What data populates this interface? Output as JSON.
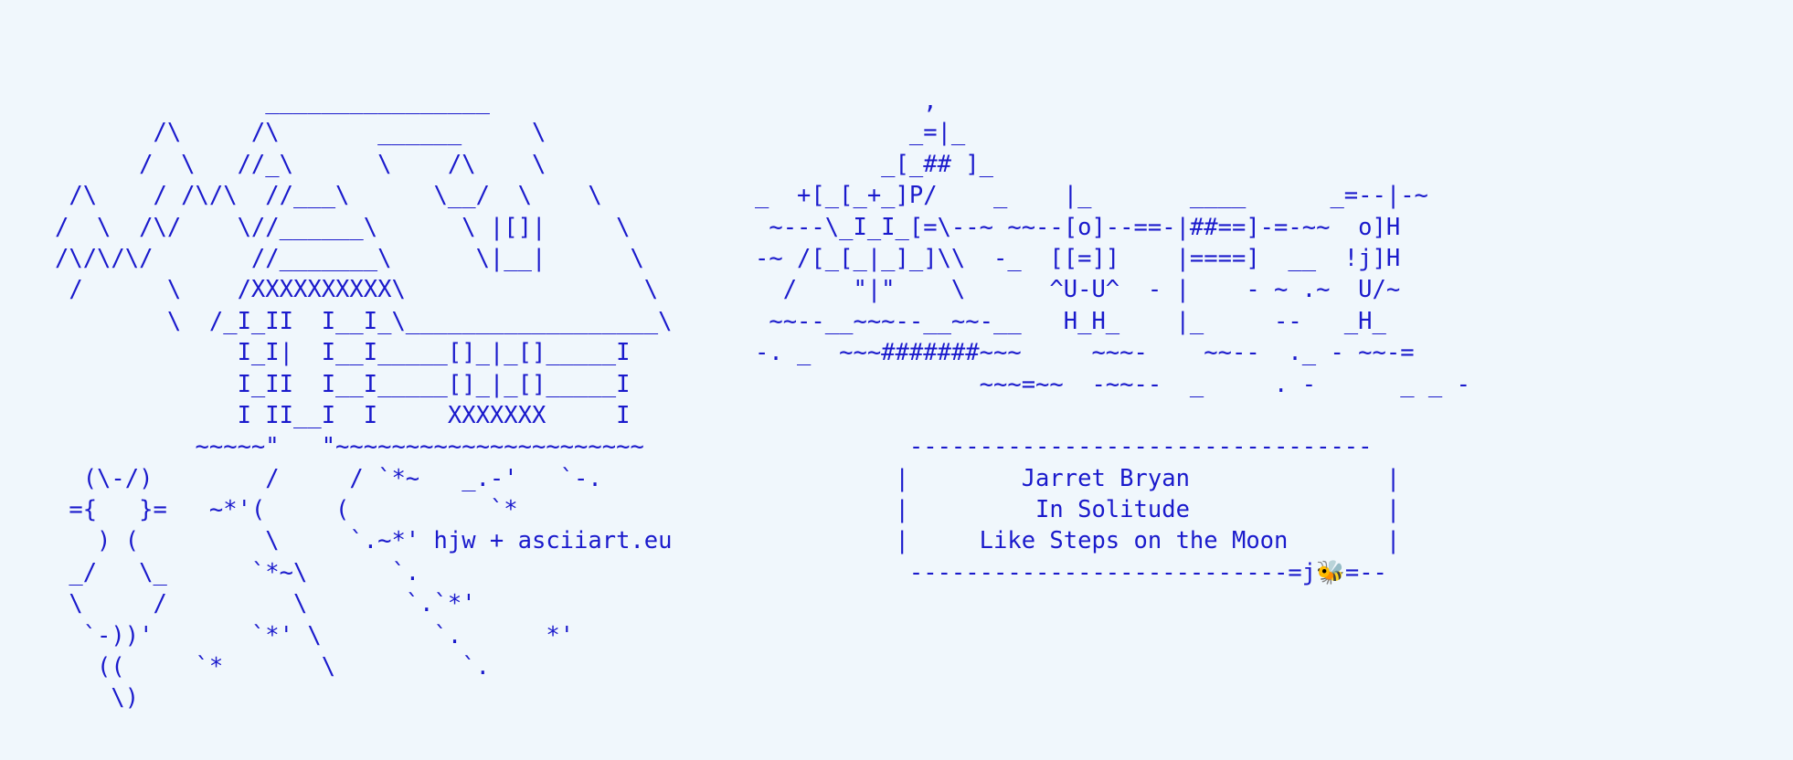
{
  "colors": {
    "background": "#f0f7fc",
    "text": "#1a1acc"
  },
  "left_art": [
    "               ________________",
    "       /\\     /\\       ______     \\",
    "      /  \\   //_\\      \\    /\\    \\",
    " /\\    / /\\/\\  //___\\      \\__/  \\    \\",
    "/  \\  /\\/    \\//______\\      \\ |[]|     \\",
    "/\\/\\/\\/       //_______\\      \\|__|      \\",
    " /      \\    /XXXXXXXXXX\\                 \\",
    "        \\  /_I_II  I__I_\\__________________\\",
    "             I_I|  I__I_____[]_|_[]_____I",
    "             I_II  I__I_____[]_|_[]_____I",
    "             I II__I  I     XXXXXXX     I",
    "          ~~~~~\"   \"~~~~~~~~~~~~~~~~~~~~~~",
    "  (\\-/)        /     / `*~   _.-'   `-.",
    " ={   }=   ~*'(     (          `*",
    "   ) (         \\     `.~*' hjw + asciiart.eu",
    " _/   \\_      `*~\\      `.",
    " \\     /         \\       `.`*'",
    "  `-))'       `*' \\        `.      *'",
    "   ((     `*       \\         `.",
    "    \\)"
  ],
  "right_art": [
    "            ,",
    "           _=|_",
    "         _[_## ]_",
    "_  +[_[_+_]P/    _    |_       ____      _=--|-~",
    " ~---\\_I_I_[=\\--~ ~~--[o]--==-|##==]-=-~~  o]H",
    "-~ /[_[_|_]_]\\\\  -_  [[=]]    |====]  __  !j]H",
    "  /    \"|\"    \\      ^U-U^  - |    - ~ .~  U/~",
    " ~~--__~~~--__~~-__   H_H_    |_     --   _H_",
    "-. _  ~~~#######~~~     ~~~-    ~~--  ._ - ~~-=",
    "                ~~~=~~  -~~--  _     . -      _ _ -",
    "",
    "           ---------------------------------",
    "          |        Jarret Bryan              |",
    "          |         In Solitude              |",
    "          |     Like Steps on the Moon       |",
    "           ---------------------------=j🐝=--"
  ]
}
